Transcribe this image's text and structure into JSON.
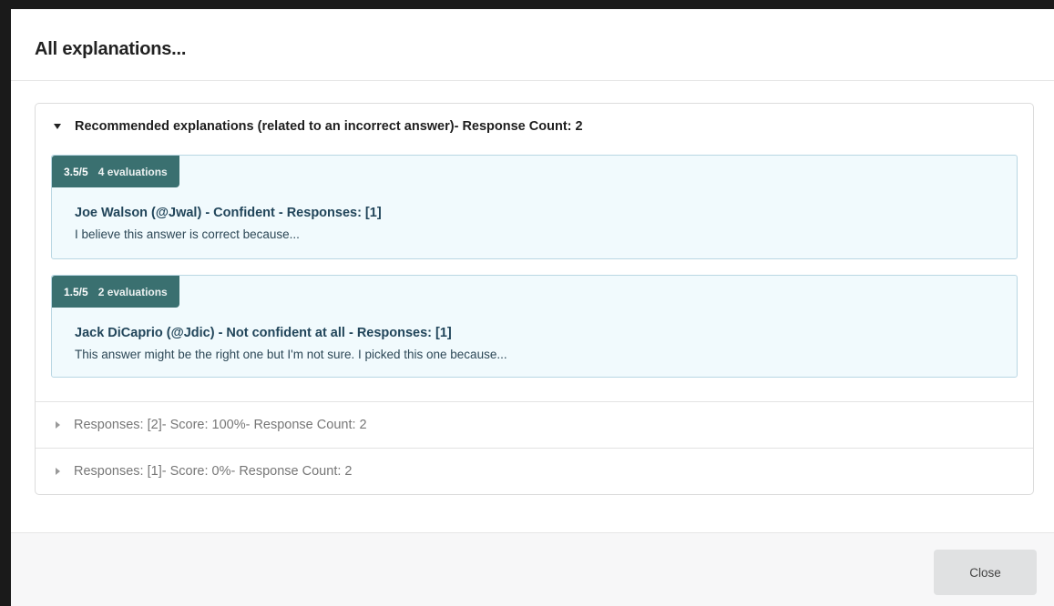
{
  "modal": {
    "title": "All explanations..."
  },
  "accordion": {
    "sections": [
      {
        "label": "Recommended explanations (related to an incorrect answer)- Response Count: 2",
        "expanded": true,
        "explanations": [
          {
            "score": "3.5/5",
            "evaluations": "4 evaluations",
            "author": "Joe Walson (@Jwal) - Confident - Responses: [1]",
            "text": "I believe this answer is correct because..."
          },
          {
            "score": "1.5/5",
            "evaluations": "2 evaluations",
            "author": "Jack DiCaprio (@Jdic) - Not confident at all - Responses: [1]",
            "text": "This answer might be the right one but I'm not sure. I picked this one because..."
          }
        ]
      },
      {
        "label": "Responses: [2]- Score: 100%- Response Count: 2",
        "expanded": false
      },
      {
        "label": "Responses: [1]- Score: 0%- Response Count: 2",
        "expanded": false
      }
    ]
  },
  "footer": {
    "close_label": "Close"
  },
  "colors": {
    "badge": "#3a7070",
    "card_bg": "#f1fafd",
    "card_border": "#b9d7e3"
  },
  "icons": {
    "expanded": "caret-down-icon",
    "collapsed": "caret-right-icon"
  }
}
